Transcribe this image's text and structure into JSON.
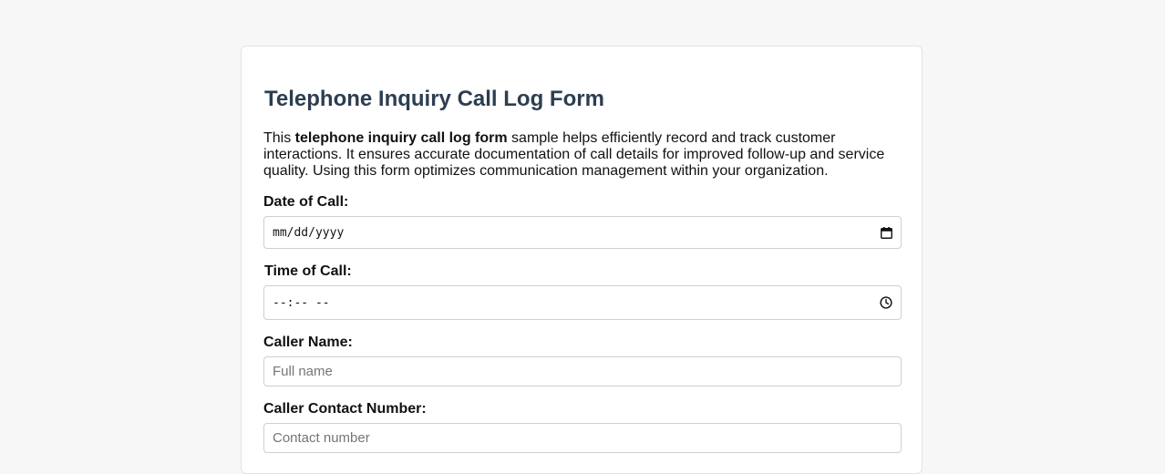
{
  "form": {
    "title": "Telephone Inquiry Call Log Form",
    "intro": {
      "prefix": "This ",
      "bold": "telephone inquiry call log form",
      "suffix": " sample helps efficiently record and track customer interactions. It ensures accurate documentation of call details for improved follow-up and service quality. Using this form optimizes communication management within your organization."
    },
    "fields": {
      "date": {
        "label": "Date of Call:",
        "value": "mm/dd/yyyy",
        "icon": "calendar-icon"
      },
      "time": {
        "label": "Time of Call:",
        "value": "--:-- --",
        "icon": "clock-icon"
      },
      "caller_name": {
        "label": "Caller Name:",
        "placeholder": "Full name"
      },
      "contact_number": {
        "label": "Caller Contact Number:",
        "placeholder": "Contact number"
      }
    }
  },
  "colors": {
    "page_background": "#f7f7f7",
    "card_background": "#ffffff",
    "title": "#2c3e50",
    "input_border": "#cfcfcf",
    "placeholder": "#757575"
  }
}
